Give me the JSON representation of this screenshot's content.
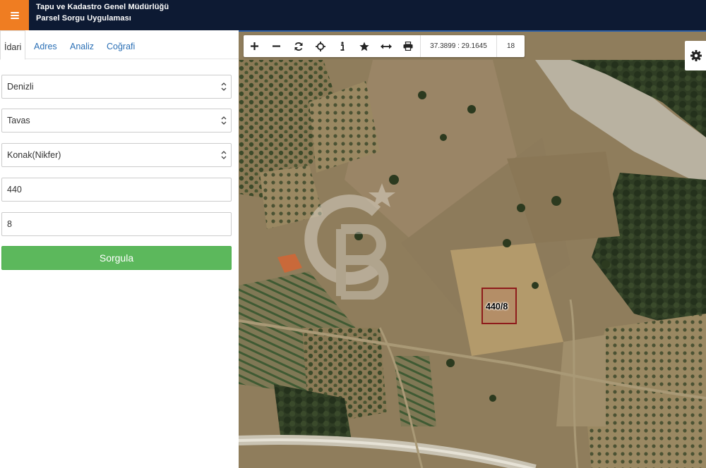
{
  "header": {
    "menu_icon": "hamburger-icon",
    "title_line1": "Tapu ve Kadastro Genel Müdürlüğü",
    "title_line2": "Parsel Sorgu Uygulaması",
    "colors": {
      "bar": "#0d1a33",
      "menu": "#ef7d22"
    }
  },
  "sidebar": {
    "tabs": [
      {
        "label": "İdari",
        "active": true
      },
      {
        "label": "Adres",
        "active": false
      },
      {
        "label": "Analiz",
        "active": false
      },
      {
        "label": "Coğrafi",
        "active": false
      }
    ],
    "province": {
      "value": "Denizli"
    },
    "district": {
      "value": "Tavas"
    },
    "neighborhood": {
      "value": "Konak(Nikfer)"
    },
    "block": {
      "value": "440"
    },
    "parcel": {
      "value": "8"
    },
    "query_button": {
      "label": "Sorgula",
      "color": "#5cb85c"
    }
  },
  "map": {
    "toolbar": {
      "tools": [
        "plus-icon",
        "minus-icon",
        "refresh-icon",
        "crosshair-icon",
        "info-icon",
        "star-icon",
        "measure-arrows-icon",
        "print-icon"
      ],
      "coordinates": "37.3899 : 29.1645",
      "zoom": "18"
    },
    "settings_icon": "gear-icon",
    "parcel_label": "440/8",
    "watermark_logo": "CB"
  }
}
